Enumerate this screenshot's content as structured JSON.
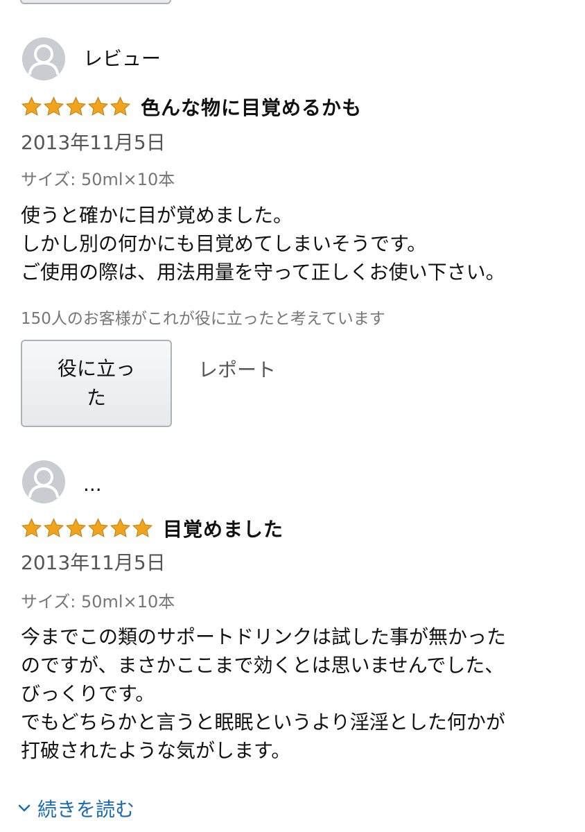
{
  "reviews": [
    {
      "profile_name": "レビュー",
      "stars": 5,
      "title": "色んな物に目覚めるかも",
      "date": "2013年11月5日",
      "size": "サイズ: 50ml×10本",
      "body": [
        "使うと確かに目が覚めました。",
        "しかし別の何かにも目覚めてしまいそうです。",
        "ご使用の際は、用法用量を守って正しくお使い下さい。"
      ],
      "helpful_count": "150人のお客様がこれが役に立ったと考えています",
      "helpful_label": "役に立った",
      "report_label": "レポート"
    },
    {
      "profile_name": "...",
      "stars": 5,
      "title": "目覚めました",
      "date": "2013年11月5日",
      "size": "サイズ: 50ml×10本",
      "body": [
        "今までこの類のサポートドリンクは試した事が無かった",
        "のですが、まさかここまで効くとは思いませんでした、",
        "びっくりです。",
        "でもどちらかと言うと眠眠というより淫淫とした何かが",
        "打破されたような気がします。"
      ]
    }
  ],
  "read_more_label": "続きを読む",
  "colors": {
    "star": "#f0a41c",
    "link": "#1a6bb3",
    "avatar": "#c9ccd0"
  },
  "icons": {
    "avatar": "person-silhouette-icon",
    "star": "star-icon",
    "read_more": "chevron-down-icon"
  }
}
